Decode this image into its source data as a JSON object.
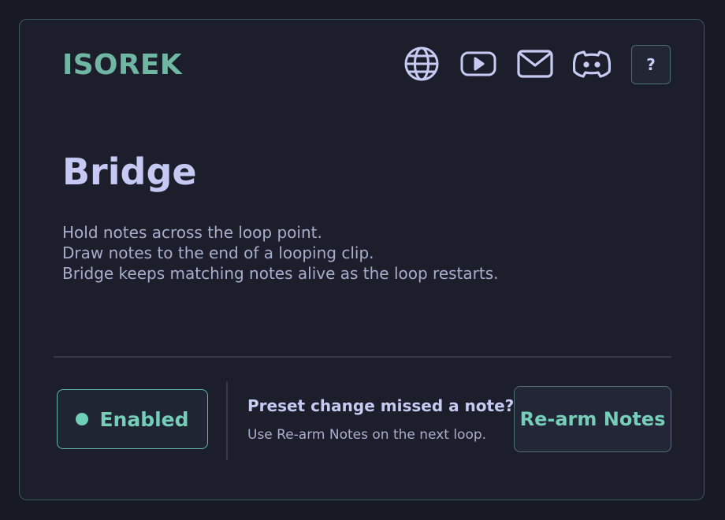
{
  "header": {
    "brand": "ISOREK",
    "icons": [
      "globe-icon",
      "youtube-icon",
      "mail-icon",
      "discord-icon"
    ],
    "help_label": "?"
  },
  "main": {
    "title": "Bridge",
    "description": [
      "Hold notes across the loop point.",
      "Draw notes to the end of a looping clip.",
      "Bridge keeps matching notes alive as the loop restarts."
    ]
  },
  "footer": {
    "enabled_label": "Enabled",
    "hint_title": "Preset change missed a note?",
    "hint_subtitle": "Use Re-arm Notes on the next loop.",
    "rearm_label": "Re-arm Notes"
  },
  "colors": {
    "background": "#171924",
    "panel": "#1c1f2b",
    "accent": "#6fb6a3",
    "enabled": "#76cdb8",
    "text_primary": "#c5c9f3",
    "text_secondary": "#a9adcc"
  }
}
